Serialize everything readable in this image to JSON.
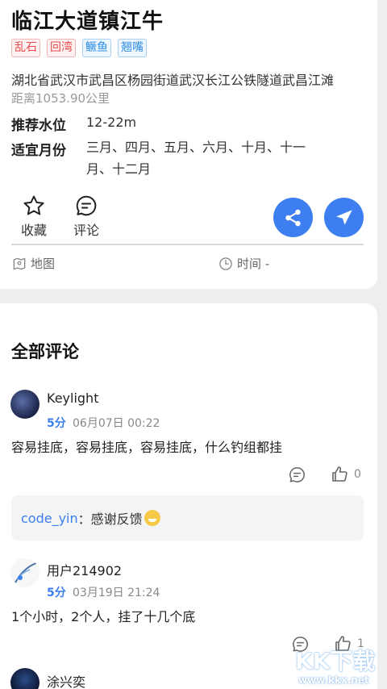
{
  "spot": {
    "title": "临江大道镇江牛",
    "tags": [
      {
        "label": "乱石",
        "color": "red"
      },
      {
        "label": "回湾",
        "color": "red"
      },
      {
        "label": "鳜鱼",
        "color": "blue"
      },
      {
        "label": "翘嘴",
        "color": "blue"
      }
    ],
    "address": "湖北省武汉市武昌区杨园街道武汉长江公铁隧道武昌江滩",
    "distance": "距离1053.90公里",
    "water_level_label": "推荐水位",
    "water_level_value": "12-22m",
    "months_label": "适宜月份",
    "months_line1": "三月、四月、五月、六月、十月、十一",
    "months_line2": "月、十二月"
  },
  "actions": {
    "favorite_label": "收藏",
    "comment_label": "评论",
    "share_icon": "share-icon",
    "navigate_icon": "navigate-icon"
  },
  "meta": {
    "map_label": "地图",
    "time_label": "时间 -"
  },
  "comments_section": {
    "title": "全部评论",
    "comments": [
      {
        "user": "Keylight",
        "score": "5分",
        "date": "06月07日 00:22",
        "text": "容易挂底，容易挂底，容易挂底，什么钓组都挂",
        "likes": "0",
        "reply": {
          "user": "code_yin",
          "colon": "：",
          "text": "感谢反馈"
        }
      },
      {
        "user": "用户214902",
        "score": "5分",
        "date": "03月19日 21:24",
        "text": "1个小时，2个人，挂了十几个底",
        "likes": "1"
      },
      {
        "user": "涂兴奕"
      }
    ]
  },
  "watermark": {
    "brand": "KK下载",
    "url": "www.kkx.net"
  },
  "colors": {
    "accent": "#3d7ef0",
    "tag_red": "#e74c4c",
    "tag_blue": "#2e8ee8"
  }
}
